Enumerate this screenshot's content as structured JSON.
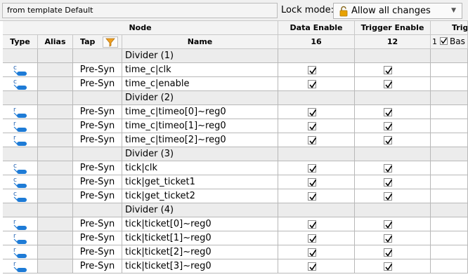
{
  "toolbar": {
    "template_label": "from template Default",
    "lock_mode_label": "Lock mode:",
    "lock_mode_value": "Allow all changes"
  },
  "columns": {
    "node_header": "Node",
    "type": "Type",
    "alias": "Alias",
    "tap": "Tap",
    "name": "Name",
    "data_enable": "Data Enable",
    "data_enable_count": "16",
    "trigger_enable": "Trigger Enable",
    "trigger_enable_count": "12",
    "trigger_cond": "Trig",
    "trigger_cond_index": "1",
    "trigger_cond_basic": "Bas"
  },
  "colors": {
    "accent": "#1e7bd6",
    "filter": "#f0a020",
    "lock": "#e8a200"
  },
  "rows": [
    {
      "kind": "divider",
      "name": "Divider (1)"
    },
    {
      "kind": "node",
      "type_letter": "c",
      "tap": "Pre-Syn",
      "name": "time_c|clk",
      "data": true,
      "trig": true
    },
    {
      "kind": "node",
      "type_letter": "c",
      "tap": "Pre-Syn",
      "name": "time_c|enable",
      "data": true,
      "trig": true
    },
    {
      "kind": "divider",
      "name": "Divider (2)"
    },
    {
      "kind": "node",
      "type_letter": "r",
      "tap": "Pre-Syn",
      "name": "time_c|timeo[0]~reg0",
      "data": true,
      "trig": true
    },
    {
      "kind": "node",
      "type_letter": "r",
      "tap": "Pre-Syn",
      "name": "time_c|timeo[1]~reg0",
      "data": true,
      "trig": true
    },
    {
      "kind": "node",
      "type_letter": "r",
      "tap": "Pre-Syn",
      "name": "time_c|timeo[2]~reg0",
      "data": true,
      "trig": true
    },
    {
      "kind": "divider",
      "name": "Divider (3)"
    },
    {
      "kind": "node",
      "type_letter": "c",
      "tap": "Pre-Syn",
      "name": "tick|clk",
      "data": true,
      "trig": true
    },
    {
      "kind": "node",
      "type_letter": "c",
      "tap": "Pre-Syn",
      "name": "tick|get_ticket1",
      "data": true,
      "trig": true
    },
    {
      "kind": "node",
      "type_letter": "c",
      "tap": "Pre-Syn",
      "name": "tick|get_ticket2",
      "data": true,
      "trig": true
    },
    {
      "kind": "divider",
      "name": "Divider (4)"
    },
    {
      "kind": "node",
      "type_letter": "r",
      "tap": "Pre-Syn",
      "name": "tick|ticket[0]~reg0",
      "data": true,
      "trig": true
    },
    {
      "kind": "node",
      "type_letter": "r",
      "tap": "Pre-Syn",
      "name": "tick|ticket[1]~reg0",
      "data": true,
      "trig": true
    },
    {
      "kind": "node",
      "type_letter": "r",
      "tap": "Pre-Syn",
      "name": "tick|ticket[2]~reg0",
      "data": true,
      "trig": true
    },
    {
      "kind": "node",
      "type_letter": "r",
      "tap": "Pre-Syn",
      "name": "tick|ticket[3]~reg0",
      "data": true,
      "trig": true
    }
  ]
}
